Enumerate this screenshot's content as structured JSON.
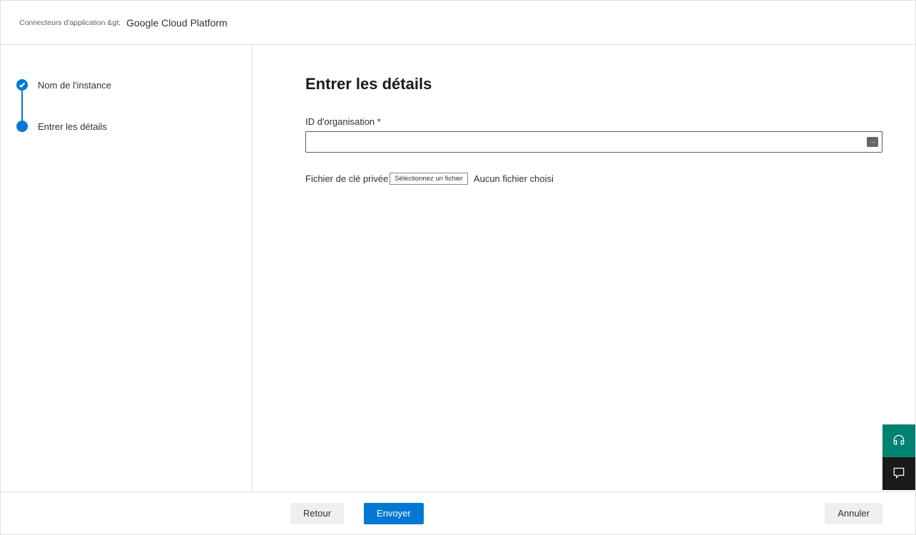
{
  "breadcrumb": {
    "prefix": "Connecteurs d'application &gt;",
    "current": "Google Cloud Platform"
  },
  "sidebar": {
    "steps": [
      {
        "label": "Nom de l'instance",
        "state": "completed"
      },
      {
        "label": "Entrer les détails",
        "state": "current"
      }
    ]
  },
  "main": {
    "title": "Entrer les détails",
    "org_id_label": "ID d'organisation *",
    "org_id_value": "",
    "file_label": "Fichier de clé privée",
    "file_button_label": "Sélectionnez un fichier",
    "file_status": "Aucun fichier choisi"
  },
  "footer": {
    "back_label": "Retour",
    "submit_label": "Envoyer",
    "cancel_label": "Annuler"
  }
}
